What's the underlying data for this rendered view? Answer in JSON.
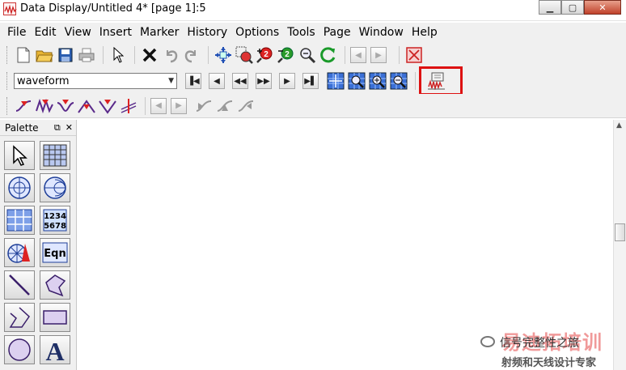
{
  "window": {
    "title": "Data Display/Untitled 4* [page 1]:5"
  },
  "menu": [
    "File",
    "Edit",
    "View",
    "Insert",
    "Marker",
    "History",
    "Options",
    "Tools",
    "Page",
    "Window",
    "Help"
  ],
  "toolbar": {
    "plot_type_select": "waveform",
    "colors": {
      "accent_red": "#dd1111",
      "blue": "#2255cc",
      "purple": "#5a2a8a"
    }
  },
  "palette": {
    "title": "Palette",
    "buttons": [
      {
        "name": "select-icon"
      },
      {
        "name": "table-grid-icon"
      },
      {
        "name": "polar-plot-icon"
      },
      {
        "name": "smith-chart-icon"
      },
      {
        "name": "data-table-icon"
      },
      {
        "name": "number-list-icon",
        "text": "1234\n5678"
      },
      {
        "name": "antenna-plot-icon"
      },
      {
        "name": "equation-icon",
        "text": "Eqn"
      },
      {
        "name": "line-icon"
      },
      {
        "name": "polygon-icon"
      },
      {
        "name": "polyline-icon"
      },
      {
        "name": "rectangle-icon"
      },
      {
        "name": "circle-icon"
      },
      {
        "name": "text-icon",
        "text": "A"
      }
    ]
  },
  "watermark": {
    "top": "易迪拓培训",
    "middle": "信号完整性之旅",
    "bottom": "射频和天线设计专家"
  }
}
